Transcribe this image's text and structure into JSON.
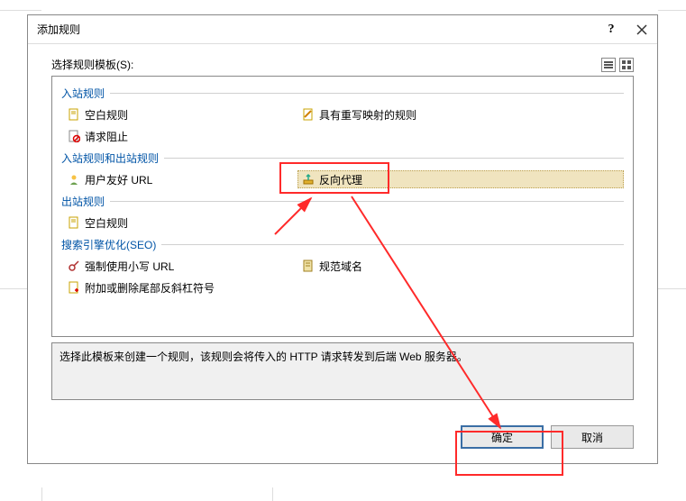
{
  "dialog": {
    "title": "添加规则"
  },
  "labels": {
    "template_select": "选择规则模板(S):"
  },
  "groups": {
    "inbound": {
      "header": "入站规则",
      "items": {
        "blank": "空白规则",
        "mapping": "具有重写映射的规则",
        "block": "请求阻止"
      }
    },
    "in_out": {
      "header": "入站规则和出站规则",
      "items": {
        "userfriendly": "用户友好 URL",
        "reverseproxy": "反向代理"
      }
    },
    "outbound": {
      "header": "出站规则",
      "items": {
        "blank": "空白规则"
      }
    },
    "seo": {
      "header": "搜索引擎优化(SEO)",
      "items": {
        "lowercase": "强制使用小写 URL",
        "trailing": "附加或删除尾部反斜杠符号",
        "canonical": "规范域名"
      }
    }
  },
  "description": "选择此模板来创建一个规则，该规则会将传入的 HTTP 请求转发到后端 Web 服务器。",
  "buttons": {
    "ok": "确定",
    "cancel": "取消"
  },
  "annotation": {
    "highlight_target": "reverseproxy",
    "arrow_from_to": [
      "reverseproxy",
      "ok-button"
    ]
  }
}
